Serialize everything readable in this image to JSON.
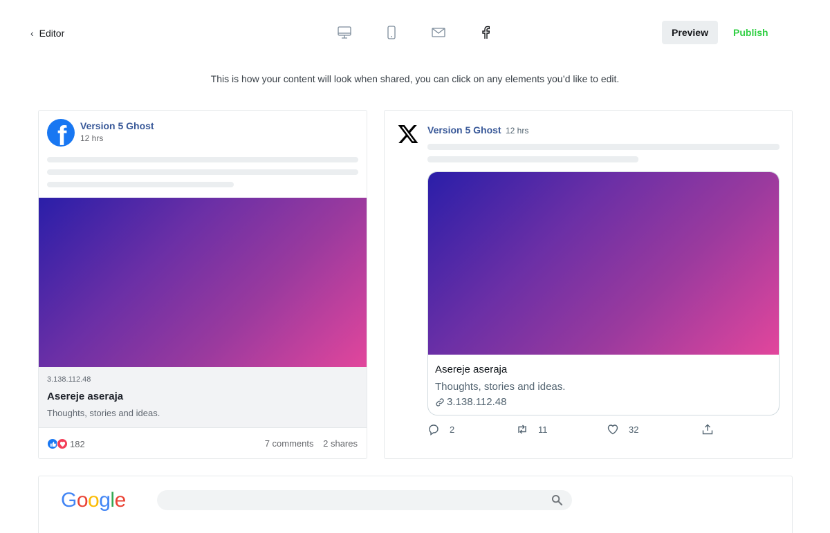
{
  "header": {
    "back_label": "Editor",
    "devices": [
      {
        "name": "desktop-icon"
      },
      {
        "name": "mobile-icon"
      },
      {
        "name": "email-icon"
      },
      {
        "name": "facebook-icon"
      }
    ],
    "preview_label": "Preview",
    "publish_label": "Publish"
  },
  "hint": "This is how your content will look when shared, you can click on any elements you’d like to edit.",
  "facebook": {
    "site_name": "Version 5 Ghost",
    "time": "12 hrs",
    "domain": "3.138.112.48",
    "title": "Asereje aseraja",
    "description": "Thoughts, stories and ideas.",
    "reaction_count": "182",
    "comments": "7 comments",
    "shares": "2 shares"
  },
  "x": {
    "site_name": "Version 5 Ghost",
    "time": "12 hrs",
    "title": "Asereje aseraja",
    "description": "Thoughts, stories and ideas.",
    "link": "3.138.112.48",
    "replies": "2",
    "retweets": "11",
    "likes": "32"
  },
  "google": {
    "logo_text": "Google"
  },
  "colors": {
    "publish": "#30cf43",
    "site_name": "#385898",
    "facebook_blue": "#1877f2",
    "gradient_start": "#2a1ea8",
    "gradient_end": "#e2469c"
  }
}
